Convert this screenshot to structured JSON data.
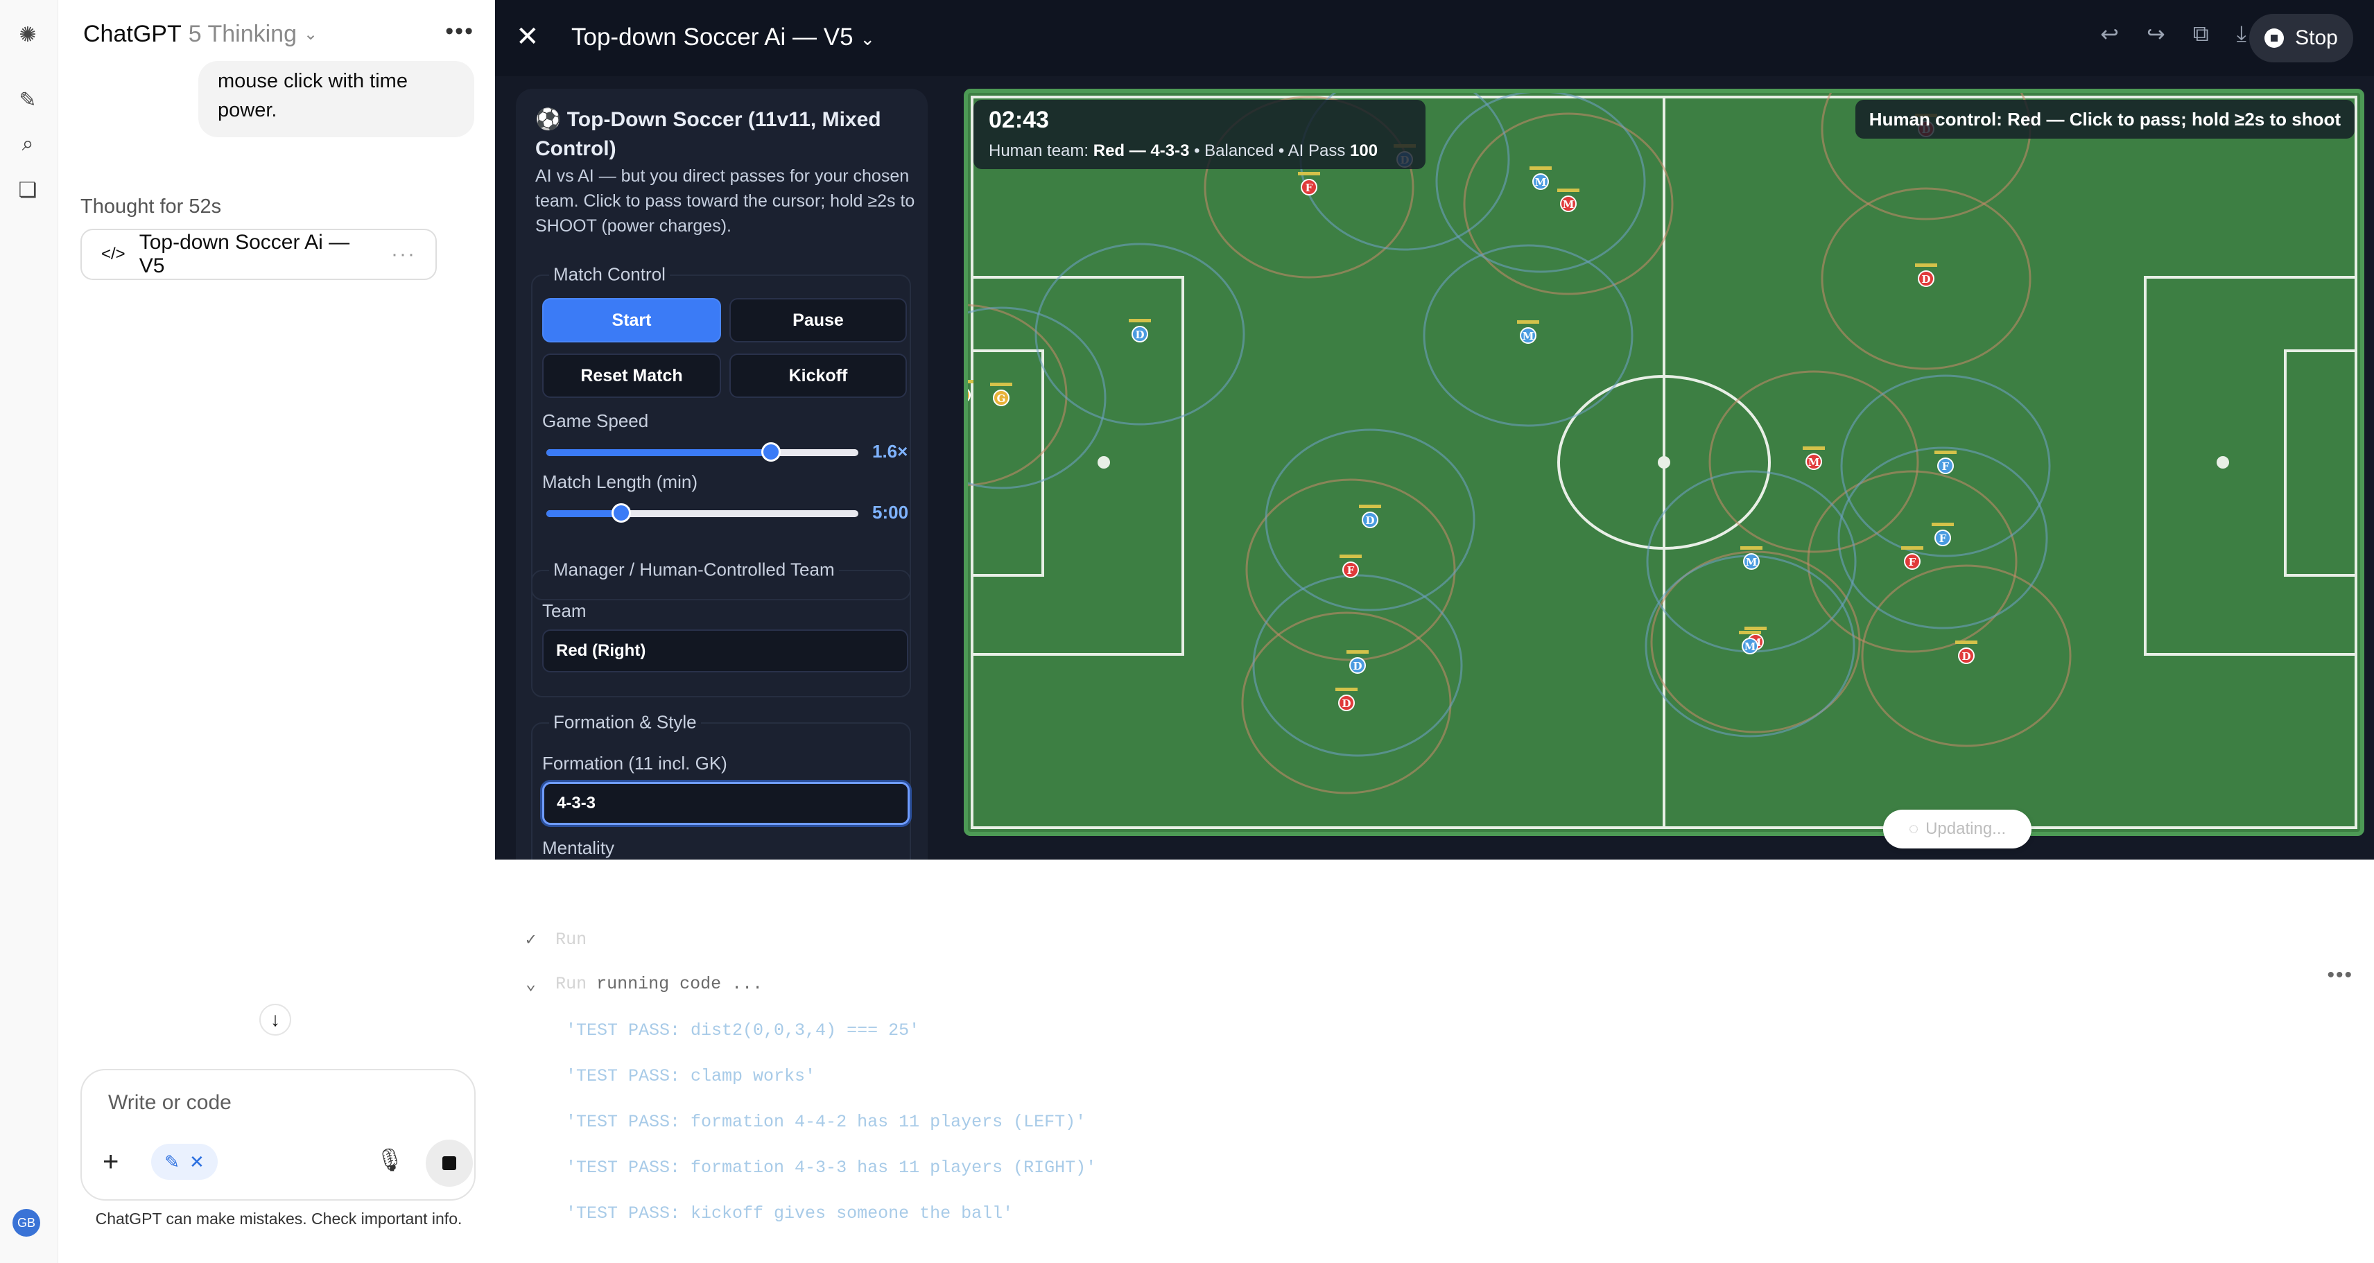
{
  "chat": {
    "app_name": "ChatGPT",
    "model": "5 Thinking",
    "user_message": "mouse click with time power.",
    "thought": "Thought for 52s",
    "artifact_title": "Top-down Soccer Ai — V5",
    "composer_placeholder": "Write or code",
    "disclaimer": "ChatGPT can make mistakes. Check important info.",
    "avatar": "GB"
  },
  "canvas": {
    "title": "Top-down Soccer Ai — V5",
    "stop_label": "Stop"
  },
  "controls": {
    "title": "Top-Down Soccer (11v11, Mixed Control)",
    "description": "AI vs AI — but you direct passes for your chosen team. Click to pass toward the cursor; hold ≥2s to SHOOT (power charges).",
    "match_control": "Match Control",
    "start": "Start",
    "pause": "Pause",
    "reset": "Reset Match",
    "kickoff": "Kickoff",
    "speed_label": "Game Speed",
    "speed_value": "1.6×",
    "speed_fraction": 0.72,
    "length_label": "Match Length (min)",
    "length_value": "5:00",
    "length_fraction": 0.24,
    "manager_title": "Manager / Human-Controlled Team",
    "team_label": "Team",
    "team_value": "Red (Right)",
    "formation_title": "Formation & Style",
    "formation_label": "Formation (11 incl. GK)",
    "formation_value": "4-3-3",
    "mentality_label": "Mentality"
  },
  "hud": {
    "clock": "02:43",
    "sub_prefix": "Human team: ",
    "sub_team": "Red — 4-3-3",
    "sub_mid": " • Balanced • AI Pass ",
    "sub_pass": "100",
    "hint": "Human control: Red — Click to pass; hold ≥2s to shoot",
    "updating": "Updating..."
  },
  "colors": {
    "pitch": "#3d7f43",
    "red": "#e03a3a",
    "blue": "#4a9be0",
    "gk": "#e8b23a"
  },
  "players": [
    {
      "team": "red",
      "role": "D"
    },
    {
      "team": "red",
      "role": "F"
    },
    {
      "team": "red",
      "role": "M"
    },
    {
      "team": "red",
      "role": "D"
    },
    {
      "team": "red",
      "role": "M"
    },
    {
      "team": "red",
      "role": "F"
    },
    {
      "team": "red",
      "role": "D"
    },
    {
      "team": "red",
      "role": "M"
    },
    {
      "team": "red",
      "role": "D"
    },
    {
      "team": "red",
      "role": "F"
    },
    {
      "team": "red",
      "role": "G"
    },
    {
      "team": "blue",
      "role": "D"
    },
    {
      "team": "blue",
      "role": "D"
    },
    {
      "team": "blue",
      "role": "M"
    },
    {
      "team": "blue",
      "role": "M"
    },
    {
      "team": "blue",
      "role": "D"
    },
    {
      "team": "blue",
      "role": "D"
    },
    {
      "team": "blue",
      "role": "M"
    },
    {
      "team": "blue",
      "role": "M"
    },
    {
      "team": "blue",
      "role": "F"
    },
    {
      "team": "blue",
      "role": "F"
    },
    {
      "team": "blue",
      "role": "G"
    }
  ],
  "log": {
    "run1": "Run",
    "run2": "Run",
    "running": "running code ...",
    "tests": [
      "'TEST PASS: dist2(0,0,3,4) === 25'",
      "'TEST PASS: clamp works'",
      "'TEST PASS: formation 4-4-2 has 11 players (LEFT)'",
      "'TEST PASS: formation 4-3-3 has 11 players (RIGHT)'",
      "'TEST PASS: kickoff gives someone the ball'"
    ]
  }
}
